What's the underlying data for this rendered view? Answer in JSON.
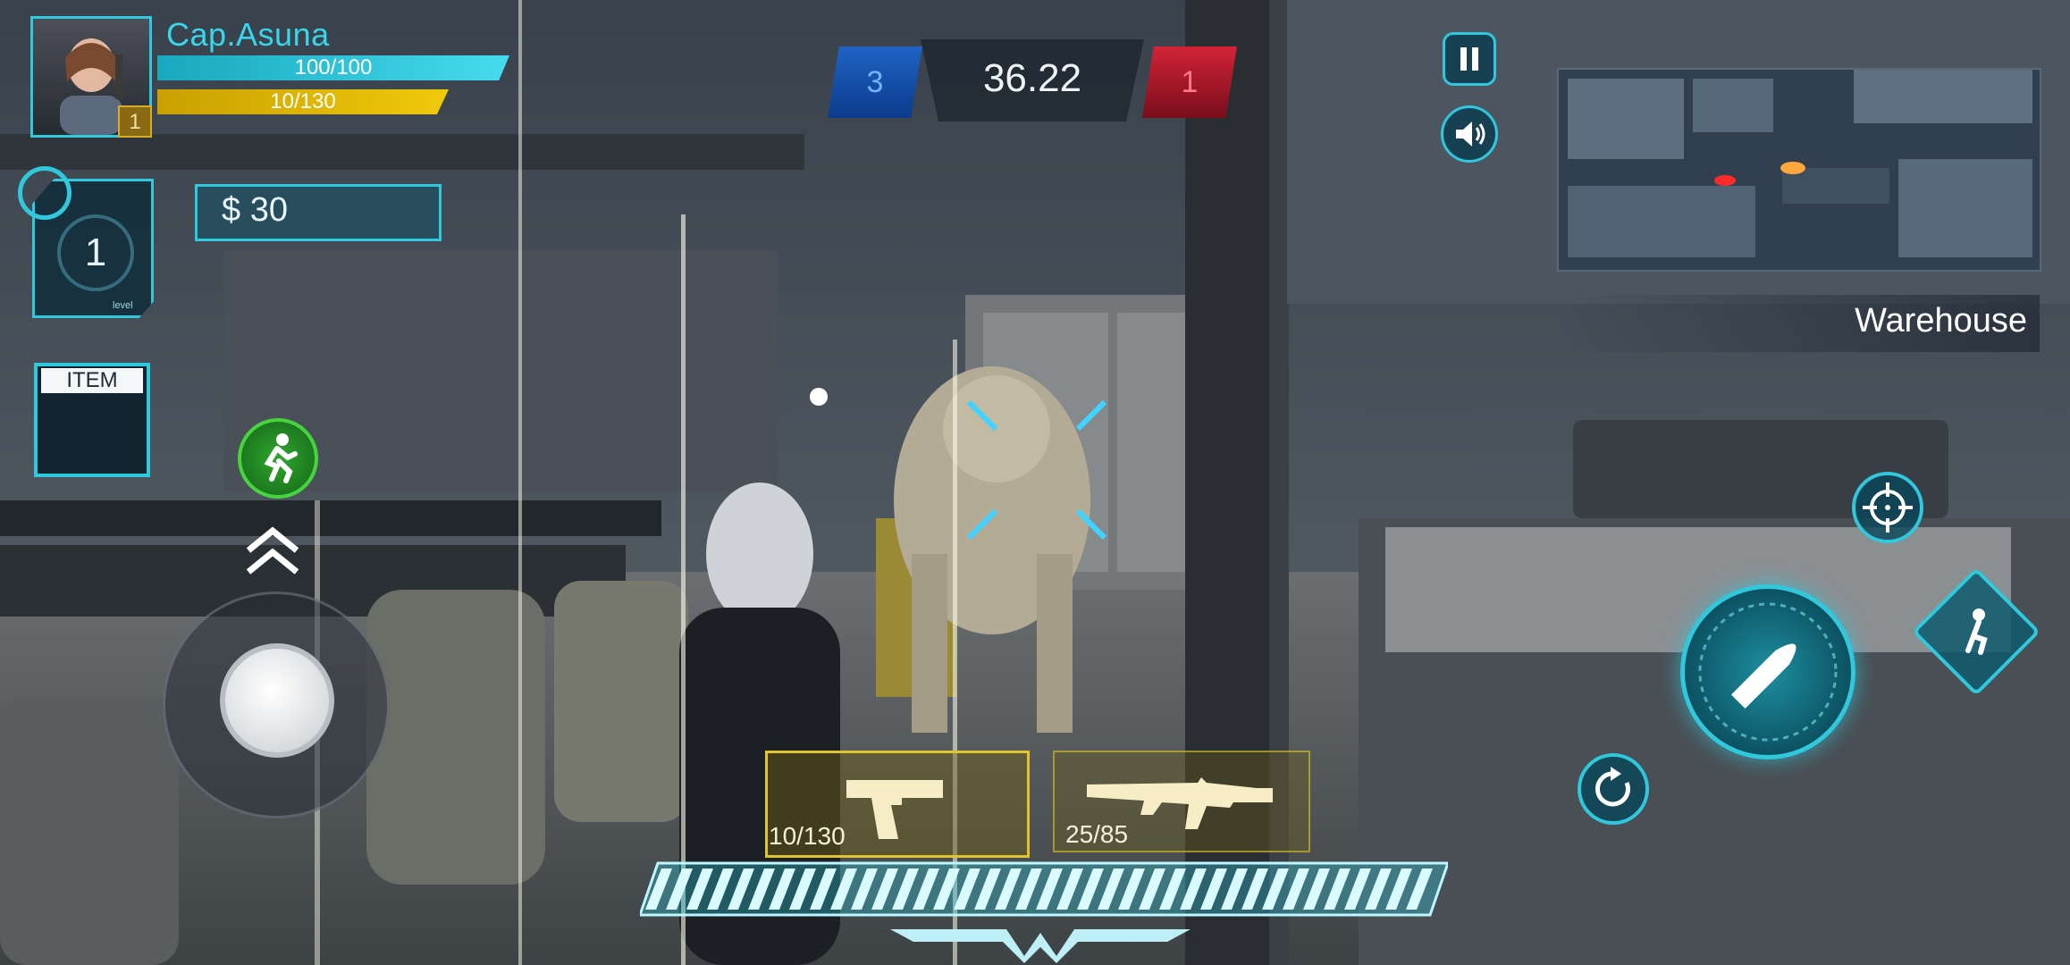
{
  "player": {
    "name": "Cap.Asuna",
    "avatar_level": "1",
    "hp_text": "100/100",
    "hp_fraction": 1.0,
    "ammo_text": "10/130",
    "ammo_fraction": 1.0
  },
  "level_card": {
    "level": "1",
    "caption": "level"
  },
  "money": {
    "text": "$ 30"
  },
  "item": {
    "label": "ITEM"
  },
  "scoreboard": {
    "blue_score": "3",
    "timer": "36.22",
    "red_score": "1"
  },
  "location": {
    "name": "Warehouse"
  },
  "weapons": [
    {
      "name": "pistol",
      "ammo": "10/130",
      "selected": true
    },
    {
      "name": "rifle",
      "ammo": "25/85",
      "selected": false
    }
  ],
  "icons": {
    "pause": "pause-icon",
    "sound": "speaker-icon",
    "sprint": "running-man-icon",
    "aim": "crosshair-icon",
    "fire": "bullet-icon",
    "crouch": "crouch-icon",
    "reload": "reload-icon",
    "jump": "double-chevron-up-icon"
  },
  "colors": {
    "accent": "#2fc8dc",
    "hp": "#46dbef",
    "ammo": "#f0c90c",
    "team_blue": "#1f63c4",
    "team_red": "#d12337",
    "weapon_slot": "#e0c32d",
    "sprint": "#48d43f"
  }
}
